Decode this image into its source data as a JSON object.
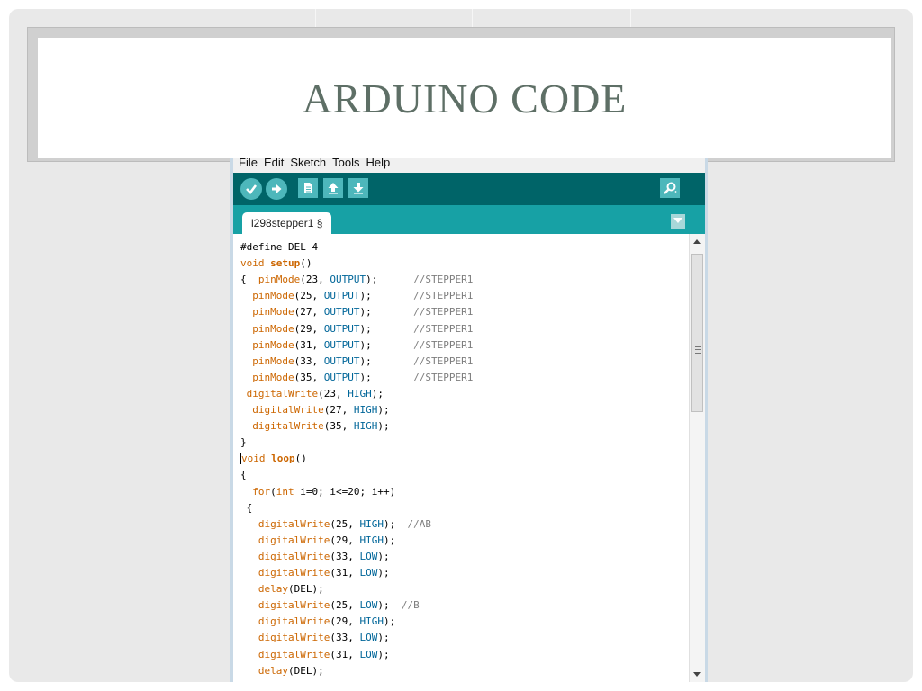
{
  "slide": {
    "title": "ARDUINO CODE"
  },
  "ide": {
    "menu": [
      "File",
      "Edit",
      "Sketch",
      "Tools",
      "Help"
    ],
    "toolbar": {
      "buttons": [
        "verify-icon",
        "upload-icon",
        "new-icon",
        "open-icon",
        "save-icon"
      ],
      "right_button": "serial-monitor-icon"
    },
    "tab": {
      "label": "l298stepper1 §"
    },
    "colors": {
      "toolbar": "#006468",
      "tabbar": "#17a1a5",
      "button": "#4db7bb"
    }
  },
  "code": [
    {
      "segs": [
        {
          "t": "#define DEL 4"
        }
      ]
    },
    {
      "segs": [
        {
          "t": "void ",
          "c": "kw"
        },
        {
          "t": "setup",
          "c": "kwb"
        },
        {
          "t": "()"
        }
      ]
    },
    {
      "segs": [
        {
          "t": "{  "
        },
        {
          "t": "pinMode",
          "c": "fn"
        },
        {
          "t": "(23, "
        },
        {
          "t": "OUTPUT",
          "c": "cn"
        },
        {
          "t": ");      "
        },
        {
          "t": "//STEPPER1",
          "c": "cm"
        }
      ]
    },
    {
      "segs": [
        {
          "t": "  "
        },
        {
          "t": "pinMode",
          "c": "fn"
        },
        {
          "t": "(25, "
        },
        {
          "t": "OUTPUT",
          "c": "cn"
        },
        {
          "t": ");       "
        },
        {
          "t": "//STEPPER1",
          "c": "cm"
        }
      ]
    },
    {
      "segs": [
        {
          "t": "  "
        },
        {
          "t": "pinMode",
          "c": "fn"
        },
        {
          "t": "(27, "
        },
        {
          "t": "OUTPUT",
          "c": "cn"
        },
        {
          "t": ");       "
        },
        {
          "t": "//STEPPER1",
          "c": "cm"
        }
      ]
    },
    {
      "segs": [
        {
          "t": "  "
        },
        {
          "t": "pinMode",
          "c": "fn"
        },
        {
          "t": "(29, "
        },
        {
          "t": "OUTPUT",
          "c": "cn"
        },
        {
          "t": ");       "
        },
        {
          "t": "//STEPPER1",
          "c": "cm"
        }
      ]
    },
    {
      "segs": [
        {
          "t": "  "
        },
        {
          "t": "pinMode",
          "c": "fn"
        },
        {
          "t": "(31, "
        },
        {
          "t": "OUTPUT",
          "c": "cn"
        },
        {
          "t": ");       "
        },
        {
          "t": "//STEPPER1",
          "c": "cm"
        }
      ]
    },
    {
      "segs": [
        {
          "t": "  "
        },
        {
          "t": "pinMode",
          "c": "fn"
        },
        {
          "t": "(33, "
        },
        {
          "t": "OUTPUT",
          "c": "cn"
        },
        {
          "t": ");       "
        },
        {
          "t": "//STEPPER1",
          "c": "cm"
        }
      ]
    },
    {
      "segs": [
        {
          "t": "  "
        },
        {
          "t": "pinMode",
          "c": "fn"
        },
        {
          "t": "(35, "
        },
        {
          "t": "OUTPUT",
          "c": "cn"
        },
        {
          "t": ");       "
        },
        {
          "t": "//STEPPER1",
          "c": "cm"
        }
      ]
    },
    {
      "segs": [
        {
          "t": " "
        },
        {
          "t": "digitalWrite",
          "c": "fn"
        },
        {
          "t": "(23, "
        },
        {
          "t": "HIGH",
          "c": "cn"
        },
        {
          "t": ");"
        }
      ]
    },
    {
      "segs": [
        {
          "t": "  "
        },
        {
          "t": "digitalWrite",
          "c": "fn"
        },
        {
          "t": "(27, "
        },
        {
          "t": "HIGH",
          "c": "cn"
        },
        {
          "t": ");"
        }
      ]
    },
    {
      "segs": [
        {
          "t": "  "
        },
        {
          "t": "digitalWrite",
          "c": "fn"
        },
        {
          "t": "(35, "
        },
        {
          "t": "HIGH",
          "c": "cn"
        },
        {
          "t": ");"
        }
      ]
    },
    {
      "segs": [
        {
          "t": "}"
        }
      ]
    },
    {
      "segs": [
        {
          "t": "void ",
          "c": "kw"
        },
        {
          "t": "loop",
          "c": "kwb"
        },
        {
          "t": "()"
        }
      ],
      "cursor": true
    },
    {
      "segs": [
        {
          "t": "{"
        }
      ]
    },
    {
      "segs": [
        {
          "t": "  "
        },
        {
          "t": "for",
          "c": "kw"
        },
        {
          "t": "("
        },
        {
          "t": "int",
          "c": "kw"
        },
        {
          "t": " i=0; i<=20; i++)"
        }
      ]
    },
    {
      "segs": [
        {
          "t": " {"
        }
      ]
    },
    {
      "segs": [
        {
          "t": "   "
        },
        {
          "t": "digitalWrite",
          "c": "fn"
        },
        {
          "t": "(25, "
        },
        {
          "t": "HIGH",
          "c": "cn"
        },
        {
          "t": ");  "
        },
        {
          "t": "//AB",
          "c": "cm"
        }
      ]
    },
    {
      "segs": [
        {
          "t": "   "
        },
        {
          "t": "digitalWrite",
          "c": "fn"
        },
        {
          "t": "(29, "
        },
        {
          "t": "HIGH",
          "c": "cn"
        },
        {
          "t": ");"
        }
      ]
    },
    {
      "segs": [
        {
          "t": "   "
        },
        {
          "t": "digitalWrite",
          "c": "fn"
        },
        {
          "t": "(33, "
        },
        {
          "t": "LOW",
          "c": "cn"
        },
        {
          "t": ");"
        }
      ]
    },
    {
      "segs": [
        {
          "t": "   "
        },
        {
          "t": "digitalWrite",
          "c": "fn"
        },
        {
          "t": "(31, "
        },
        {
          "t": "LOW",
          "c": "cn"
        },
        {
          "t": ");"
        }
      ]
    },
    {
      "segs": [
        {
          "t": "   "
        },
        {
          "t": "delay",
          "c": "fn"
        },
        {
          "t": "(DEL);"
        }
      ]
    },
    {
      "segs": [
        {
          "t": "   "
        },
        {
          "t": "digitalWrite",
          "c": "fn"
        },
        {
          "t": "(25, "
        },
        {
          "t": "LOW",
          "c": "cn"
        },
        {
          "t": ");  "
        },
        {
          "t": "//B",
          "c": "cm"
        }
      ]
    },
    {
      "segs": [
        {
          "t": "   "
        },
        {
          "t": "digitalWrite",
          "c": "fn"
        },
        {
          "t": "(29, "
        },
        {
          "t": "HIGH",
          "c": "cn"
        },
        {
          "t": ");"
        }
      ]
    },
    {
      "segs": [
        {
          "t": "   "
        },
        {
          "t": "digitalWrite",
          "c": "fn"
        },
        {
          "t": "(33, "
        },
        {
          "t": "LOW",
          "c": "cn"
        },
        {
          "t": ");"
        }
      ]
    },
    {
      "segs": [
        {
          "t": "   "
        },
        {
          "t": "digitalWrite",
          "c": "fn"
        },
        {
          "t": "(31, "
        },
        {
          "t": "LOW",
          "c": "cn"
        },
        {
          "t": ");"
        }
      ]
    },
    {
      "segs": [
        {
          "t": "   "
        },
        {
          "t": "delay",
          "c": "fn"
        },
        {
          "t": "(DEL);"
        }
      ]
    }
  ]
}
